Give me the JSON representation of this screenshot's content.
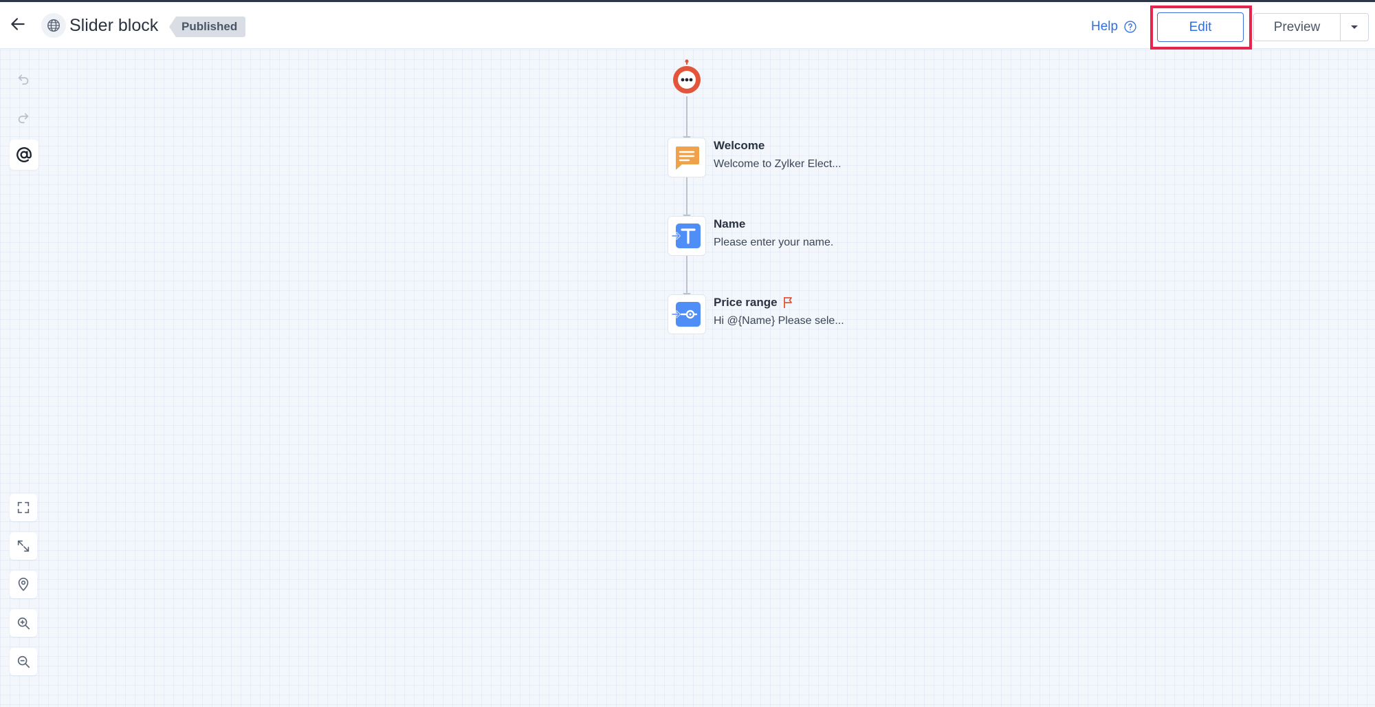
{
  "header": {
    "bot_name": "Slider block",
    "status": "Published",
    "help_label": "Help",
    "edit_label": "Edit",
    "preview_label": "Preview",
    "accent_color": "#2f6fde",
    "highlight_color": "#e5264c"
  },
  "toolbar": {
    "top": [
      "undo-icon",
      "redo-icon",
      "at-sign-icon"
    ],
    "bottom": [
      "fit-screen-icon",
      "expand-icon",
      "location-pin-icon",
      "zoom-in-icon",
      "zoom-out-icon"
    ]
  },
  "flow": {
    "start_icon": "bot-start-icon",
    "blocks": [
      {
        "title": "Welcome",
        "description": "Welcome to Zylker Elect...",
        "icon": "message-icon",
        "icon_color": "#f0a24a"
      },
      {
        "title": "Name",
        "description": "Please enter your name.",
        "icon": "text-input-icon",
        "icon_color": "#4f8ef7"
      },
      {
        "title": "Price range",
        "description": "Hi  @{Name}  Please sele...",
        "icon": "slider-input-icon",
        "icon_color": "#4f8ef7",
        "flag_icon": "flag-icon"
      }
    ]
  }
}
